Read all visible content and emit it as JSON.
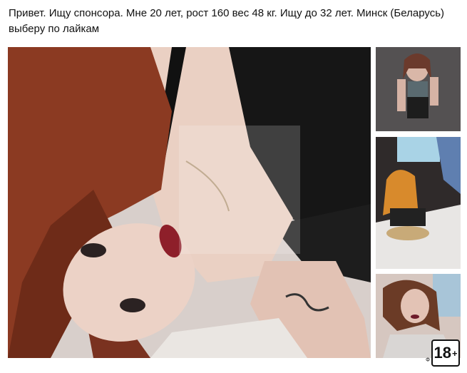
{
  "post": {
    "text": "Привет. Ищу спонсора. Мне 20 лет, рост 160 вес 48 кг. Ищу до 32 лет. Минск (Беларусь) выберу по лайкам"
  },
  "photos": {
    "main_alt": "",
    "thumbs": [
      "",
      "",
      ""
    ]
  },
  "badge": {
    "age_number": "18",
    "age_plus": "+",
    "corner_mark": "Ф"
  },
  "colors": {
    "hair": "#8b3a22",
    "skin": "#e8c9bb",
    "top_black": "#1a1a1a",
    "lips": "#8e1f2a",
    "sheet": "#eae6e2"
  }
}
